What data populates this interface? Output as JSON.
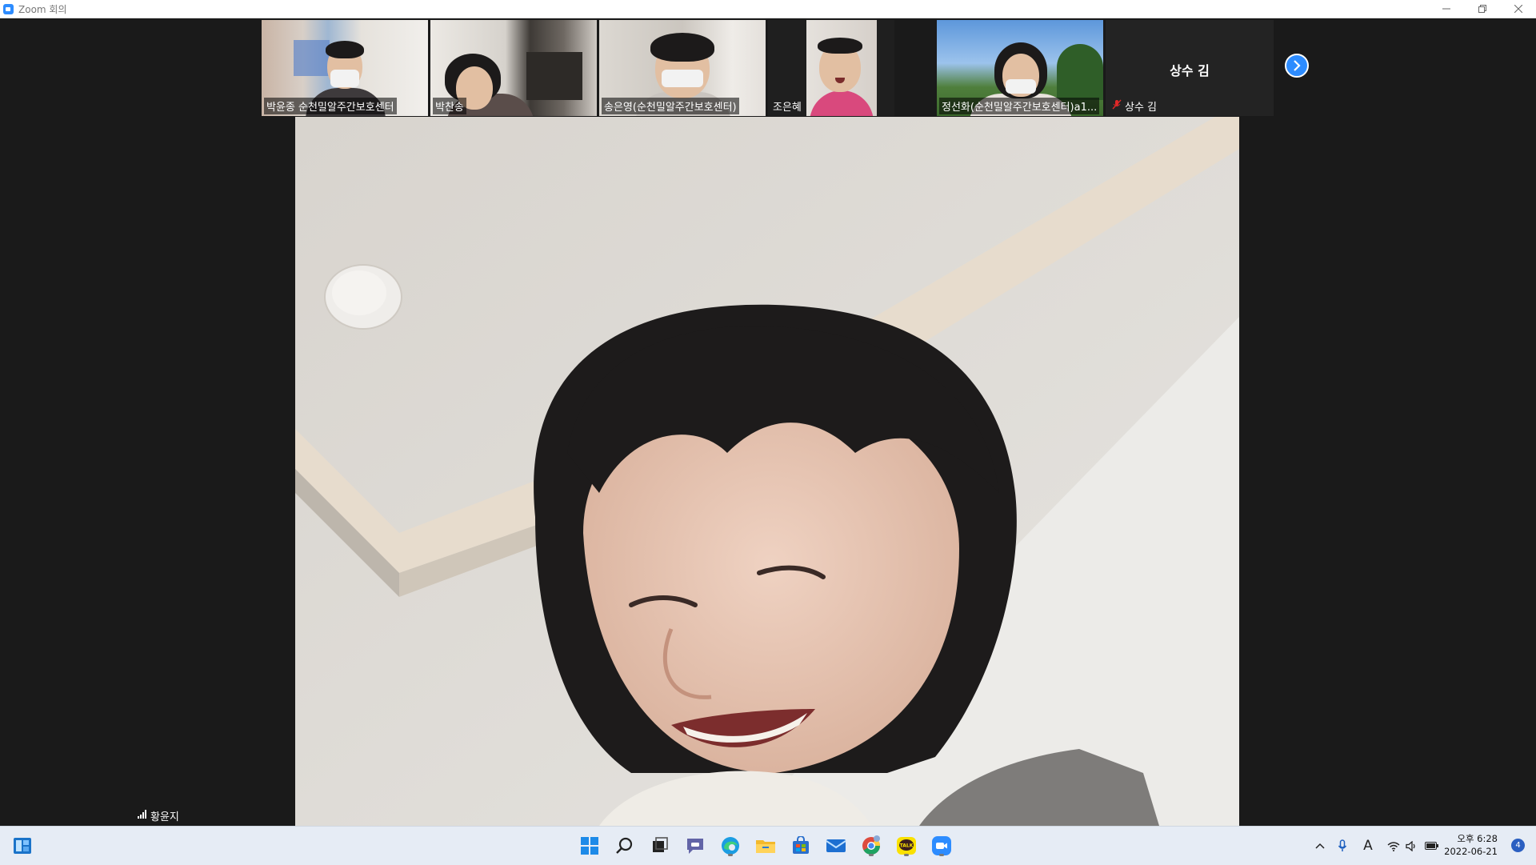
{
  "window": {
    "title": "Zoom 회의",
    "controls": [
      "minimize-icon",
      "restore-icon",
      "close-icon"
    ]
  },
  "gallery": {
    "participants": [
      {
        "name": "박윤종 순천밀알주간보호센터",
        "video": true
      },
      {
        "name": "박찬송",
        "video": true
      },
      {
        "name": "송은영(순천밀알주간보호센터)",
        "video": true
      },
      {
        "name": "조은혜",
        "video": true
      },
      {
        "name": "정선화(순천밀알주간보호센터)a1...",
        "video": true
      }
    ],
    "avatar_tile": {
      "display_name": "상수 김",
      "label": "상수 김",
      "muted": true
    },
    "next_page_icon": "chevron-right-icon"
  },
  "speaker": {
    "name": "황윤지",
    "signal_icon": "signal-bars-icon"
  },
  "taskbar": {
    "apps": [
      "widgets-icon",
      "start-icon",
      "search-icon",
      "task-view-icon",
      "teams-chat-icon",
      "edge-icon",
      "file-explorer-icon",
      "store-icon",
      "mail-icon",
      "chrome-icon",
      "kakaotalk-icon",
      "zoom-icon"
    ],
    "kakao_text": "TALK",
    "tray": {
      "ime_label": "A",
      "time": "오후 6:28",
      "date": "2022-06-21",
      "notifications": "4"
    }
  },
  "colors": {
    "accent": "#2d8cff",
    "background": "#1a1a1a",
    "taskbar": "#e6ecf5"
  }
}
